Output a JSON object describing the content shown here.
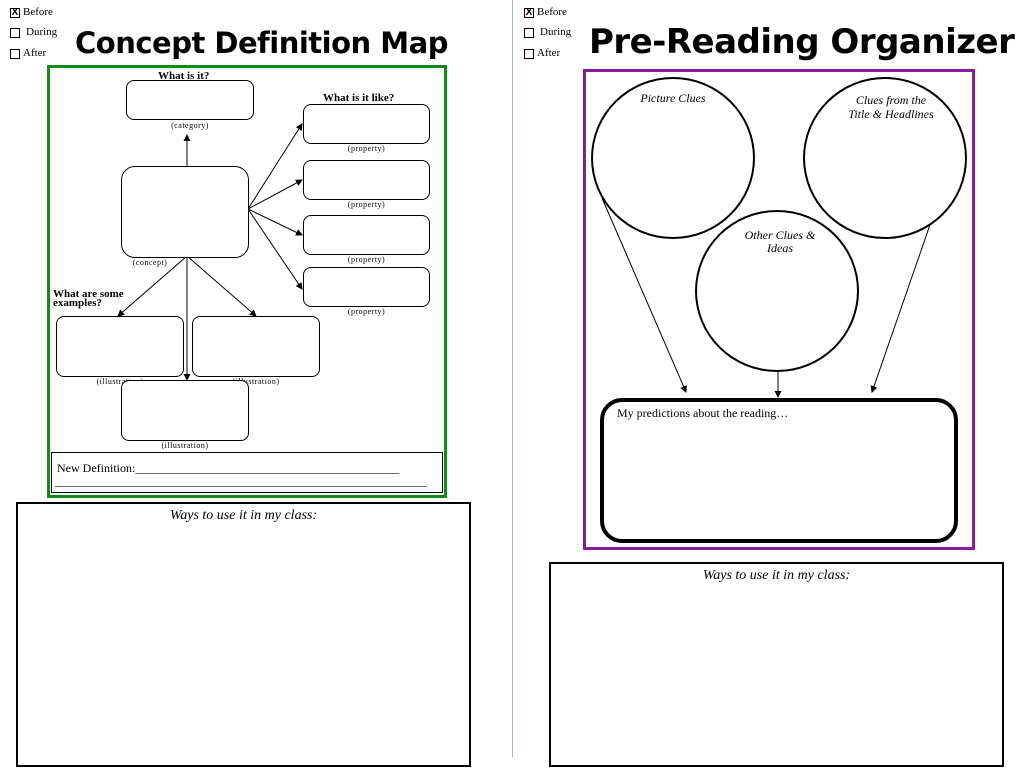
{
  "left": {
    "checklist": [
      {
        "label": "Before",
        "checked": true,
        "mark": "X"
      },
      {
        "label": "During",
        "checked": false,
        "mark": ""
      },
      {
        "label": "After",
        "checked": false,
        "mark": ""
      }
    ],
    "title": "Concept Definition Map",
    "frame_color": "#168a16",
    "what_is_it": "What is it?",
    "category_caption": "(category)",
    "what_is_it_like": "What is it like?",
    "property_caption": "(property)",
    "concept_caption": "(concept)",
    "examples_heading_line1": "What are some",
    "examples_heading_line2": "examples?",
    "illustration_caption": "(illustration)",
    "new_definition": "New Definition:____________________________________________",
    "definition_line": "______________________________________________________________",
    "ways_label": "Ways to use it in my class:"
  },
  "right": {
    "checklist": [
      {
        "label": "Before",
        "checked": true,
        "mark": "X"
      },
      {
        "label": "During",
        "checked": false,
        "mark": ""
      },
      {
        "label": "After",
        "checked": false,
        "mark": ""
      }
    ],
    "title": "Pre-Reading Organizer",
    "frame_color": "#8a1a9e",
    "picture_clues": "Picture Clues",
    "title_clues_line1": "Clues from the",
    "title_clues_line2": "Title & Headlines",
    "other_clues_line1": "Other Clues &",
    "other_clues_line2": "Ideas",
    "predictions": "My predictions about the reading…",
    "ways_label": "Ways to use it in my class:"
  },
  "divider_color": "#9fb8cf"
}
